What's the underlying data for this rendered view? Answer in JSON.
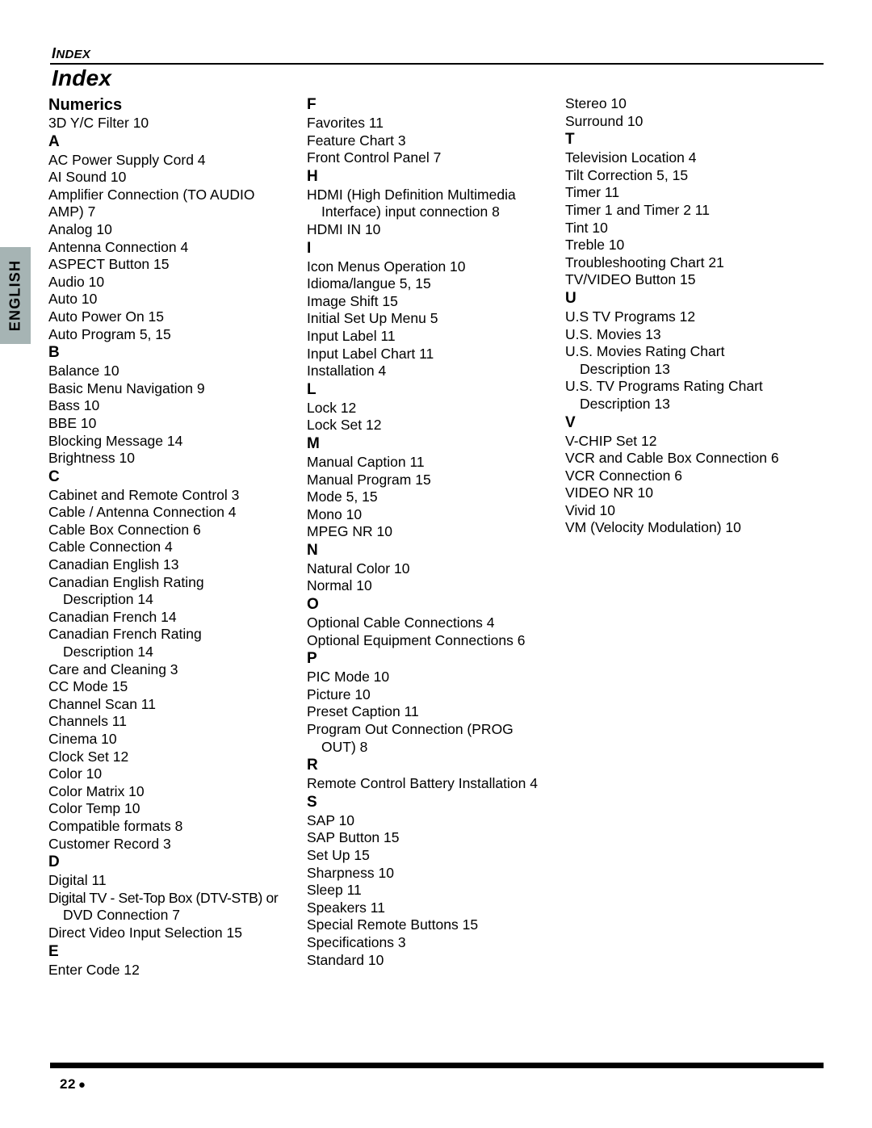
{
  "running_head": {
    "label": "INDEX",
    "first_letter": "I",
    "rest": "NDEX"
  },
  "page_title": "Index",
  "side_tab": {
    "label": "ENGLISH",
    "color": "#a6b4b4"
  },
  "footer": {
    "page_number": "22",
    "bullet": "●"
  },
  "columns": [
    {
      "id": "column-1",
      "blocks": [
        {
          "heading": "Numerics",
          "heading_style": "word",
          "entries": [
            {
              "text": "3D Y/C Filter 10",
              "cont": false
            }
          ]
        },
        {
          "heading": "A",
          "heading_style": "letter",
          "entries": [
            {
              "text": "AC Power Supply Cord 4",
              "cont": false
            },
            {
              "text": "AI Sound 10",
              "cont": false
            },
            {
              "text": "Amplifier Connection (TO AUDIO",
              "cont": false
            },
            {
              "text": "AMP) 7",
              "cont": false
            },
            {
              "text": "Analog 10",
              "cont": false
            },
            {
              "text": "Antenna Connection 4",
              "cont": false
            },
            {
              "text": "ASPECT Button 15",
              "cont": false
            },
            {
              "text": "Audio 10",
              "cont": false
            },
            {
              "text": "Auto 10",
              "cont": false
            },
            {
              "text": "Auto Power On 15",
              "cont": false
            },
            {
              "text": "Auto Program 5, 15",
              "cont": false
            }
          ]
        },
        {
          "heading": "B",
          "heading_style": "letter",
          "entries": [
            {
              "text": "Balance 10",
              "cont": false
            },
            {
              "text": "Basic Menu Navigation 9",
              "cont": false
            },
            {
              "text": "Bass 10",
              "cont": false
            },
            {
              "text": "BBE 10",
              "cont": false
            },
            {
              "text": "Blocking Message 14",
              "cont": false
            },
            {
              "text": "Brightness 10",
              "cont": false
            }
          ]
        },
        {
          "heading": "C",
          "heading_style": "letter",
          "entries": [
            {
              "text": "Cabinet and Remote Control 3",
              "cont": false
            },
            {
              "text": "Cable / Antenna Connection 4",
              "cont": false
            },
            {
              "text": "Cable Box Connection 6",
              "cont": false
            },
            {
              "text": "Cable Connection 4",
              "cont": false
            },
            {
              "text": "Canadian English 13",
              "cont": false
            },
            {
              "text": "Canadian English Rating",
              "cont": false
            },
            {
              "text": "Description 14",
              "cont": true
            },
            {
              "text": "Canadian French 14",
              "cont": false
            },
            {
              "text": "Canadian French Rating",
              "cont": false
            },
            {
              "text": "Description 14",
              "cont": true
            },
            {
              "text": "Care and Cleaning 3",
              "cont": false
            },
            {
              "text": "CC Mode 15",
              "cont": false
            },
            {
              "text": "Channel Scan 11",
              "cont": false
            },
            {
              "text": "Channels 11",
              "cont": false
            },
            {
              "text": "Cinema 10",
              "cont": false
            },
            {
              "text": "Clock Set 12",
              "cont": false
            },
            {
              "text": "Color 10",
              "cont": false
            },
            {
              "text": "Color Matrix 10",
              "cont": false
            },
            {
              "text": "Color Temp 10",
              "cont": false
            },
            {
              "text": "Compatible formats 8",
              "cont": false
            },
            {
              "text": "Customer Record 3",
              "cont": false
            }
          ]
        },
        {
          "heading": "D",
          "heading_style": "letter",
          "entries": [
            {
              "text": "Digital 11",
              "cont": false
            },
            {
              "text": "Digital TV - Set-Top Box (DTV-STB) or",
              "cont": false,
              "tight": true
            },
            {
              "text": "DVD Connection 7",
              "cont": true
            },
            {
              "text": "Direct Video Input Selection 15",
              "cont": false
            }
          ]
        },
        {
          "heading": "E",
          "heading_style": "letter",
          "entries": [
            {
              "text": "Enter Code 12",
              "cont": false
            }
          ]
        }
      ]
    },
    {
      "id": "column-2",
      "blocks": [
        {
          "heading": "F",
          "heading_style": "letter",
          "entries": [
            {
              "text": "Favorites 11",
              "cont": false
            },
            {
              "text": "Feature Chart 3",
              "cont": false
            },
            {
              "text": "Front Control Panel 7",
              "cont": false
            }
          ]
        },
        {
          "heading": "H",
          "heading_style": "letter",
          "entries": [
            {
              "text": "HDMI (High Definition Multimedia",
              "cont": false
            },
            {
              "text": "Interface) input connection 8",
              "cont": true
            },
            {
              "text": "HDMI IN 10",
              "cont": false
            }
          ]
        },
        {
          "heading": "I",
          "heading_style": "letter",
          "entries": [
            {
              "text": "Icon Menus Operation 10",
              "cont": false
            },
            {
              "text": "Idioma/langue 5, 15",
              "cont": false
            },
            {
              "text": "Image Shift 15",
              "cont": false
            },
            {
              "text": "Initial Set Up Menu 5",
              "cont": false
            },
            {
              "text": "Input Label 11",
              "cont": false
            },
            {
              "text": "Input Label Chart 11",
              "cont": false
            },
            {
              "text": "Installation 4",
              "cont": false
            }
          ]
        },
        {
          "heading": "L",
          "heading_style": "letter",
          "entries": [
            {
              "text": "Lock 12",
              "cont": false
            },
            {
              "text": "Lock Set 12",
              "cont": false
            }
          ]
        },
        {
          "heading": "M",
          "heading_style": "letter",
          "entries": [
            {
              "text": "Manual Caption 11",
              "cont": false
            },
            {
              "text": "Manual Program 15",
              "cont": false
            },
            {
              "text": "Mode 5, 15",
              "cont": false
            },
            {
              "text": "Mono 10",
              "cont": false
            },
            {
              "text": "MPEG NR 10",
              "cont": false
            }
          ]
        },
        {
          "heading": "N",
          "heading_style": "letter",
          "entries": [
            {
              "text": "Natural Color 10",
              "cont": false
            },
            {
              "text": "Normal 10",
              "cont": false
            }
          ]
        },
        {
          "heading": "O",
          "heading_style": "letter",
          "entries": [
            {
              "text": "Optional Cable Connections 4",
              "cont": false
            },
            {
              "text": "Optional Equipment Connections 6",
              "cont": false
            }
          ]
        },
        {
          "heading": "P",
          "heading_style": "letter",
          "entries": [
            {
              "text": "PIC Mode 10",
              "cont": false
            },
            {
              "text": "Picture 10",
              "cont": false
            },
            {
              "text": "Preset Caption 11",
              "cont": false
            },
            {
              "text": "Program Out Connection (PROG",
              "cont": false
            },
            {
              "text": "OUT) 8",
              "cont": true
            }
          ]
        },
        {
          "heading": "R",
          "heading_style": "letter",
          "entries": [
            {
              "text": "Remote Control Battery Installation 4",
              "cont": false
            }
          ]
        },
        {
          "heading": "S",
          "heading_style": "letter",
          "entries": [
            {
              "text": "SAP 10",
              "cont": false
            },
            {
              "text": "SAP Button 15",
              "cont": false
            },
            {
              "text": "Set Up 15",
              "cont": false
            },
            {
              "text": "Sharpness 10",
              "cont": false
            },
            {
              "text": "Sleep 11",
              "cont": false
            },
            {
              "text": "Speakers 11",
              "cont": false
            },
            {
              "text": "Special Remote Buttons 15",
              "cont": false
            },
            {
              "text": "Specifications 3",
              "cont": false
            },
            {
              "text": "Standard 10",
              "cont": false
            }
          ]
        }
      ]
    },
    {
      "id": "column-3",
      "blocks": [
        {
          "heading": null,
          "heading_style": "letter",
          "entries": [
            {
              "text": "Stereo 10",
              "cont": false
            },
            {
              "text": "Surround 10",
              "cont": false
            }
          ]
        },
        {
          "heading": "T",
          "heading_style": "letter",
          "entries": [
            {
              "text": "Television Location 4",
              "cont": false
            },
            {
              "text": "Tilt Correction 5, 15",
              "cont": false
            },
            {
              "text": "Timer 11",
              "cont": false
            },
            {
              "text": "Timer 1 and Timer 2 11",
              "cont": false
            },
            {
              "text": "Tint 10",
              "cont": false
            },
            {
              "text": "Treble 10",
              "cont": false
            },
            {
              "text": "Troubleshooting Chart 21",
              "cont": false
            },
            {
              "text": "TV/VIDEO Button 15",
              "cont": false
            }
          ]
        },
        {
          "heading": "U",
          "heading_style": "letter",
          "entries": [
            {
              "text": "U.S TV Programs 12",
              "cont": false
            },
            {
              "text": "U.S. Movies 13",
              "cont": false
            },
            {
              "text": "U.S. Movies Rating Chart",
              "cont": false
            },
            {
              "text": "Description 13",
              "cont": true
            },
            {
              "text": "U.S. TV Programs Rating Chart",
              "cont": false
            },
            {
              "text": "Description 13",
              "cont": true
            }
          ]
        },
        {
          "heading": "V",
          "heading_style": "letter",
          "entries": [
            {
              "text": "V-CHIP Set 12",
              "cont": false
            },
            {
              "text": "VCR and Cable Box Connection 6",
              "cont": false
            },
            {
              "text": "VCR Connection 6",
              "cont": false
            },
            {
              "text": "VIDEO NR 10",
              "cont": false
            },
            {
              "text": "Vivid 10",
              "cont": false
            },
            {
              "text": "VM (Velocity Modulation) 10",
              "cont": false
            }
          ]
        }
      ]
    }
  ]
}
